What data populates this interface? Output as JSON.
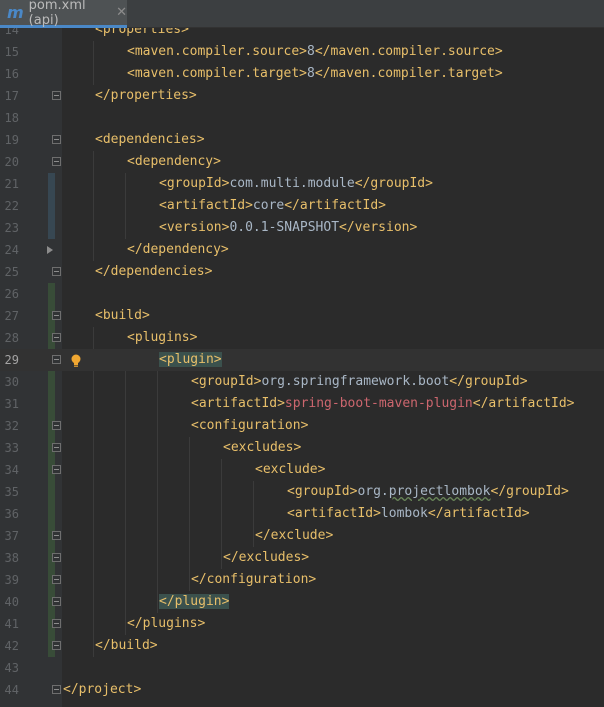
{
  "tab": {
    "icon": "maven-icon",
    "label": "pom.xml (api)",
    "close": "✕"
  },
  "colors": {
    "tag": "#e8bf6a",
    "text": "#a9b7c6",
    "error": "#cc666e",
    "match_highlight": "#3b514d",
    "vcs_added": "#384c38",
    "vcs_modified": "#374752"
  },
  "lines": [
    {
      "number": "14",
      "indent": 1,
      "segments": [
        {
          "t": "<properties>",
          "c": "tag"
        }
      ]
    },
    {
      "number": "15",
      "indent": 2,
      "segments": [
        {
          "t": "<maven.compiler.source>",
          "c": "tag"
        },
        {
          "t": "8",
          "c": "txt"
        },
        {
          "t": "</maven.compiler.source>",
          "c": "tag"
        }
      ]
    },
    {
      "number": "16",
      "indent": 2,
      "segments": [
        {
          "t": "<maven.compiler.target>",
          "c": "tag"
        },
        {
          "t": "8",
          "c": "txt"
        },
        {
          "t": "</maven.compiler.target>",
          "c": "tag"
        }
      ]
    },
    {
      "number": "17",
      "indent": 1,
      "segments": [
        {
          "t": "</properties>",
          "c": "tag"
        }
      ]
    },
    {
      "number": "18",
      "indent": 0,
      "segments": []
    },
    {
      "number": "19",
      "indent": 1,
      "segments": [
        {
          "t": "<dependencies>",
          "c": "tag"
        }
      ]
    },
    {
      "number": "20",
      "indent": 2,
      "segments": [
        {
          "t": "<dependency>",
          "c": "tag"
        }
      ]
    },
    {
      "number": "21",
      "indent": 3,
      "segments": [
        {
          "t": "<groupId>",
          "c": "tag"
        },
        {
          "t": "com.multi.module",
          "c": "txt"
        },
        {
          "t": "</groupId>",
          "c": "tag"
        }
      ]
    },
    {
      "number": "22",
      "indent": 3,
      "segments": [
        {
          "t": "<artifactId>",
          "c": "tag"
        },
        {
          "t": "core",
          "c": "txt"
        },
        {
          "t": "</artifactId>",
          "c": "tag"
        }
      ]
    },
    {
      "number": "23",
      "indent": 3,
      "segments": [
        {
          "t": "<version>",
          "c": "tag"
        },
        {
          "t": "0.0.1-SNAPSHOT",
          "c": "txt"
        },
        {
          "t": "</version>",
          "c": "tag"
        }
      ]
    },
    {
      "number": "24",
      "indent": 2,
      "segments": [
        {
          "t": "</dependency>",
          "c": "tag"
        }
      ]
    },
    {
      "number": "25",
      "indent": 1,
      "segments": [
        {
          "t": "</dependencies>",
          "c": "tag"
        }
      ]
    },
    {
      "number": "26",
      "indent": 0,
      "segments": []
    },
    {
      "number": "27",
      "indent": 1,
      "segments": [
        {
          "t": "<build>",
          "c": "tag"
        }
      ]
    },
    {
      "number": "28",
      "indent": 2,
      "segments": [
        {
          "t": "<plugins>",
          "c": "tag"
        }
      ]
    },
    {
      "number": "29",
      "indent": 3,
      "current": true,
      "segments": [
        {
          "t": "<plugin>",
          "c": "tag hl"
        }
      ]
    },
    {
      "number": "30",
      "indent": 4,
      "segments": [
        {
          "t": "<groupId>",
          "c": "tag"
        },
        {
          "t": "org.springframework.boot",
          "c": "txt"
        },
        {
          "t": "</groupId>",
          "c": "tag"
        }
      ]
    },
    {
      "number": "31",
      "indent": 4,
      "segments": [
        {
          "t": "<artifactId>",
          "c": "tag"
        },
        {
          "t": "spring-boot-maven-plugin",
          "c": "err"
        },
        {
          "t": "</artifactId>",
          "c": "tag"
        }
      ]
    },
    {
      "number": "32",
      "indent": 4,
      "segments": [
        {
          "t": "<configuration>",
          "c": "tag"
        }
      ]
    },
    {
      "number": "33",
      "indent": 5,
      "segments": [
        {
          "t": "<excludes>",
          "c": "tag"
        }
      ]
    },
    {
      "number": "34",
      "indent": 6,
      "segments": [
        {
          "t": "<exclude>",
          "c": "tag"
        }
      ]
    },
    {
      "number": "35",
      "indent": 7,
      "segments": [
        {
          "t": "<groupId>",
          "c": "tag"
        },
        {
          "t": "org.",
          "c": "txt"
        },
        {
          "t": "projectlombok",
          "c": "txt uline"
        },
        {
          "t": "</groupId>",
          "c": "tag"
        }
      ]
    },
    {
      "number": "36",
      "indent": 7,
      "segments": [
        {
          "t": "<artifactId>",
          "c": "tag"
        },
        {
          "t": "lombok",
          "c": "txt"
        },
        {
          "t": "</artifactId>",
          "c": "tag"
        }
      ]
    },
    {
      "number": "37",
      "indent": 6,
      "segments": [
        {
          "t": "</exclude>",
          "c": "tag"
        }
      ]
    },
    {
      "number": "38",
      "indent": 5,
      "segments": [
        {
          "t": "</excludes>",
          "c": "tag"
        }
      ]
    },
    {
      "number": "39",
      "indent": 4,
      "segments": [
        {
          "t": "</configuration>",
          "c": "tag"
        }
      ]
    },
    {
      "number": "40",
      "indent": 3,
      "segments": [
        {
          "t": "</plugin>",
          "c": "tag hl"
        }
      ]
    },
    {
      "number": "41",
      "indent": 2,
      "segments": [
        {
          "t": "</plugins>",
          "c": "tag"
        }
      ]
    },
    {
      "number": "42",
      "indent": 1,
      "segments": [
        {
          "t": "</build>",
          "c": "tag"
        }
      ]
    },
    {
      "number": "43",
      "indent": 0,
      "segments": []
    },
    {
      "number": "44",
      "indent": 0,
      "segments": [
        {
          "t": "</project>",
          "c": "tag"
        }
      ]
    }
  ],
  "fold_markers": [
    "19",
    "20",
    "27",
    "28",
    "29",
    "32",
    "33",
    "34",
    "37",
    "38",
    "39",
    "40",
    "41",
    "42",
    "44",
    "17",
    "25"
  ],
  "intention_bulb_line": "29"
}
